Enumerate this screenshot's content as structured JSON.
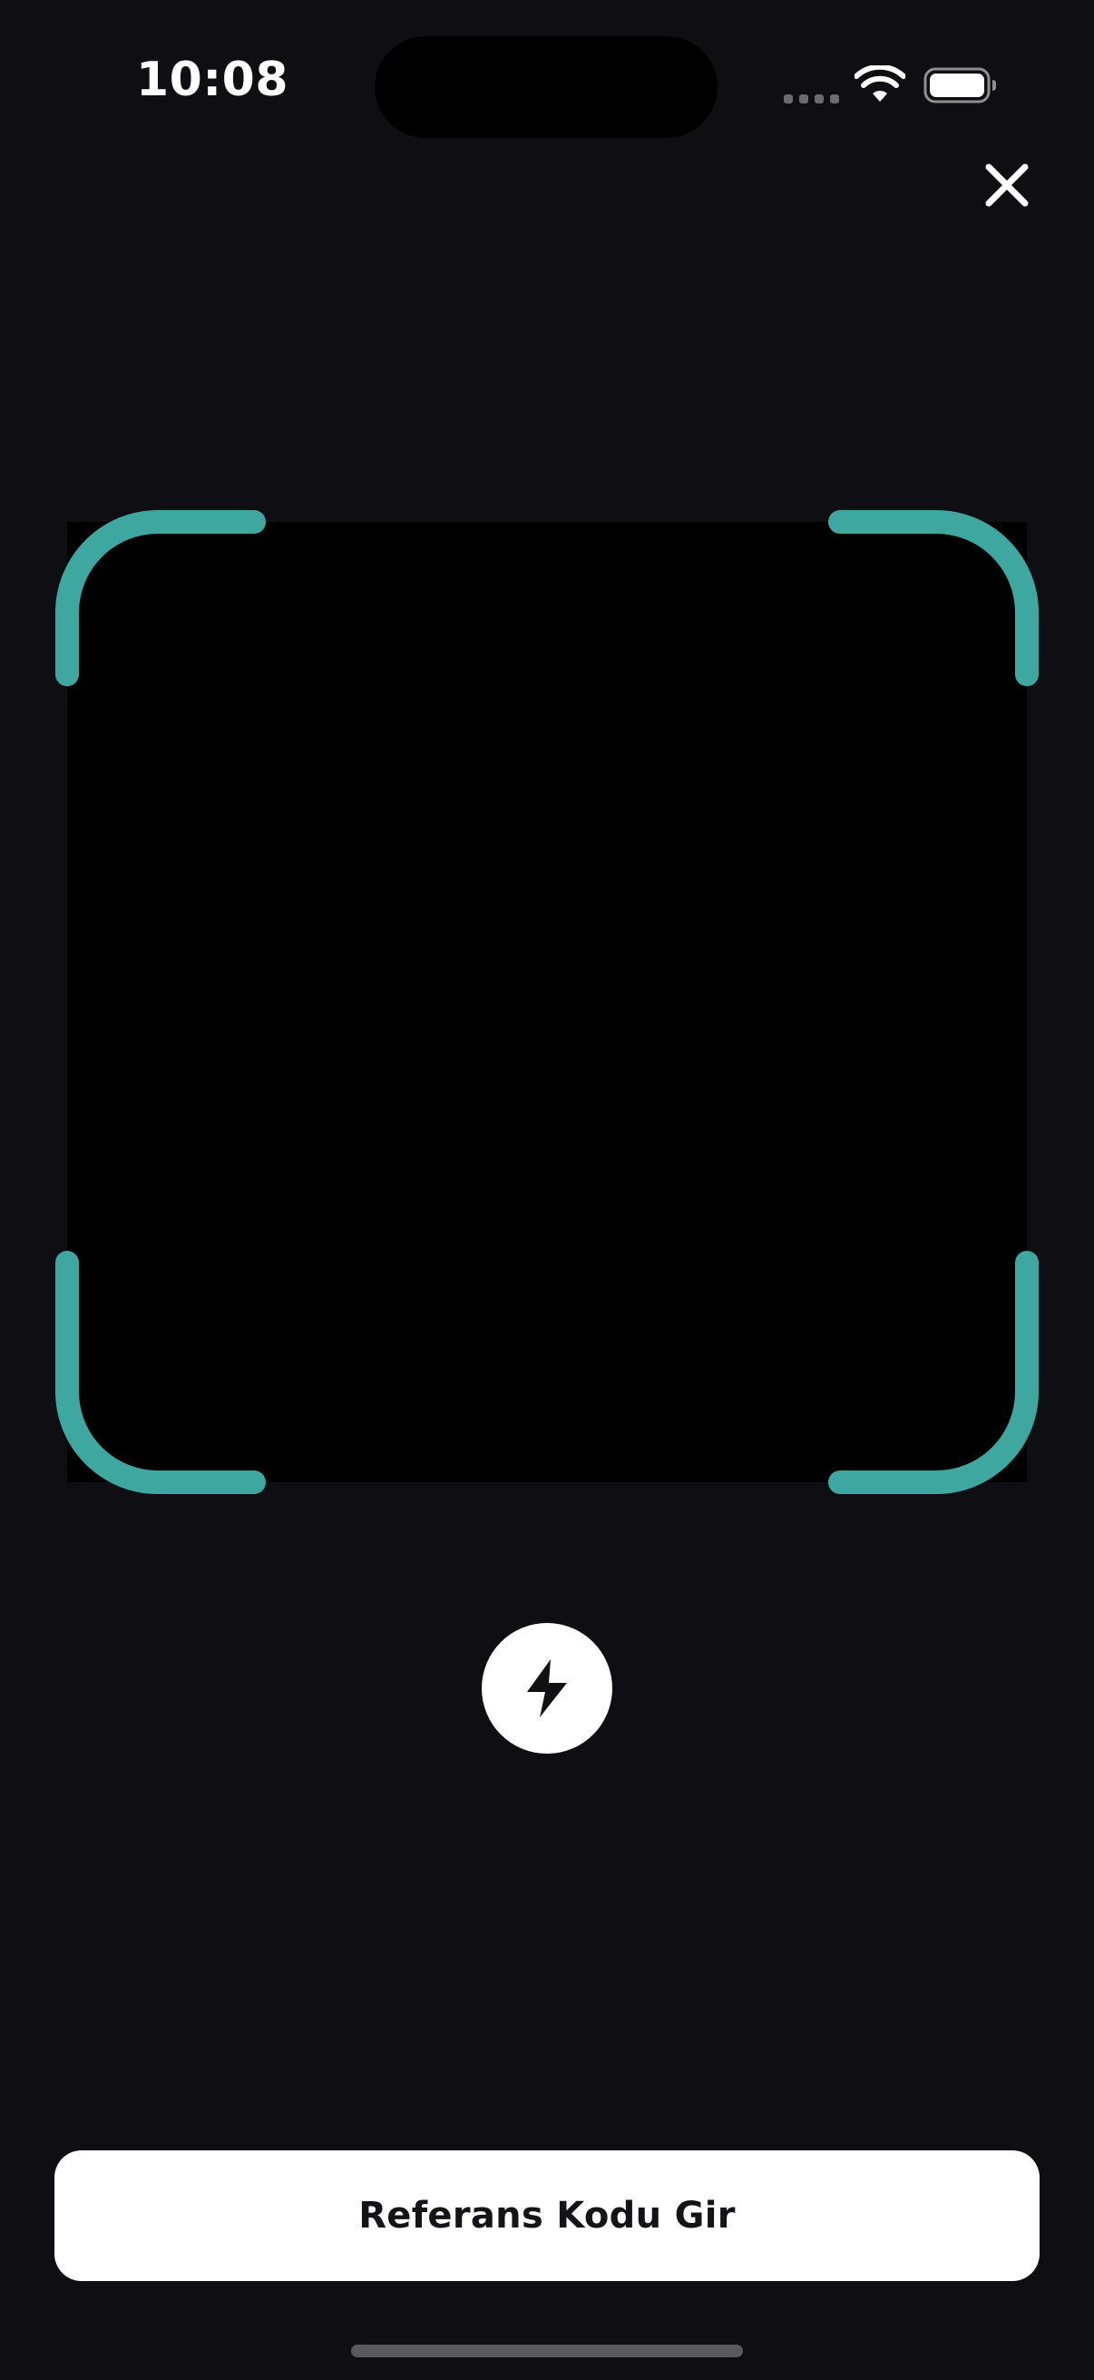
{
  "status_bar": {
    "time": "10:08",
    "icons": [
      "cellular-signal-icon",
      "wifi-icon",
      "battery-icon"
    ]
  },
  "header": {
    "close_icon": "close-icon"
  },
  "scanner": {
    "corner_color": "#3ea8a0",
    "view_color": "#000000"
  },
  "flash_toggle": {
    "icon": "flash-icon"
  },
  "actions": {
    "referral_code_label": "Referans Kodu Gir"
  },
  "colors": {
    "background": "#0f0f13",
    "accent": "#3ea8a0",
    "button_bg": "#ffffff",
    "button_text": "#141418"
  }
}
